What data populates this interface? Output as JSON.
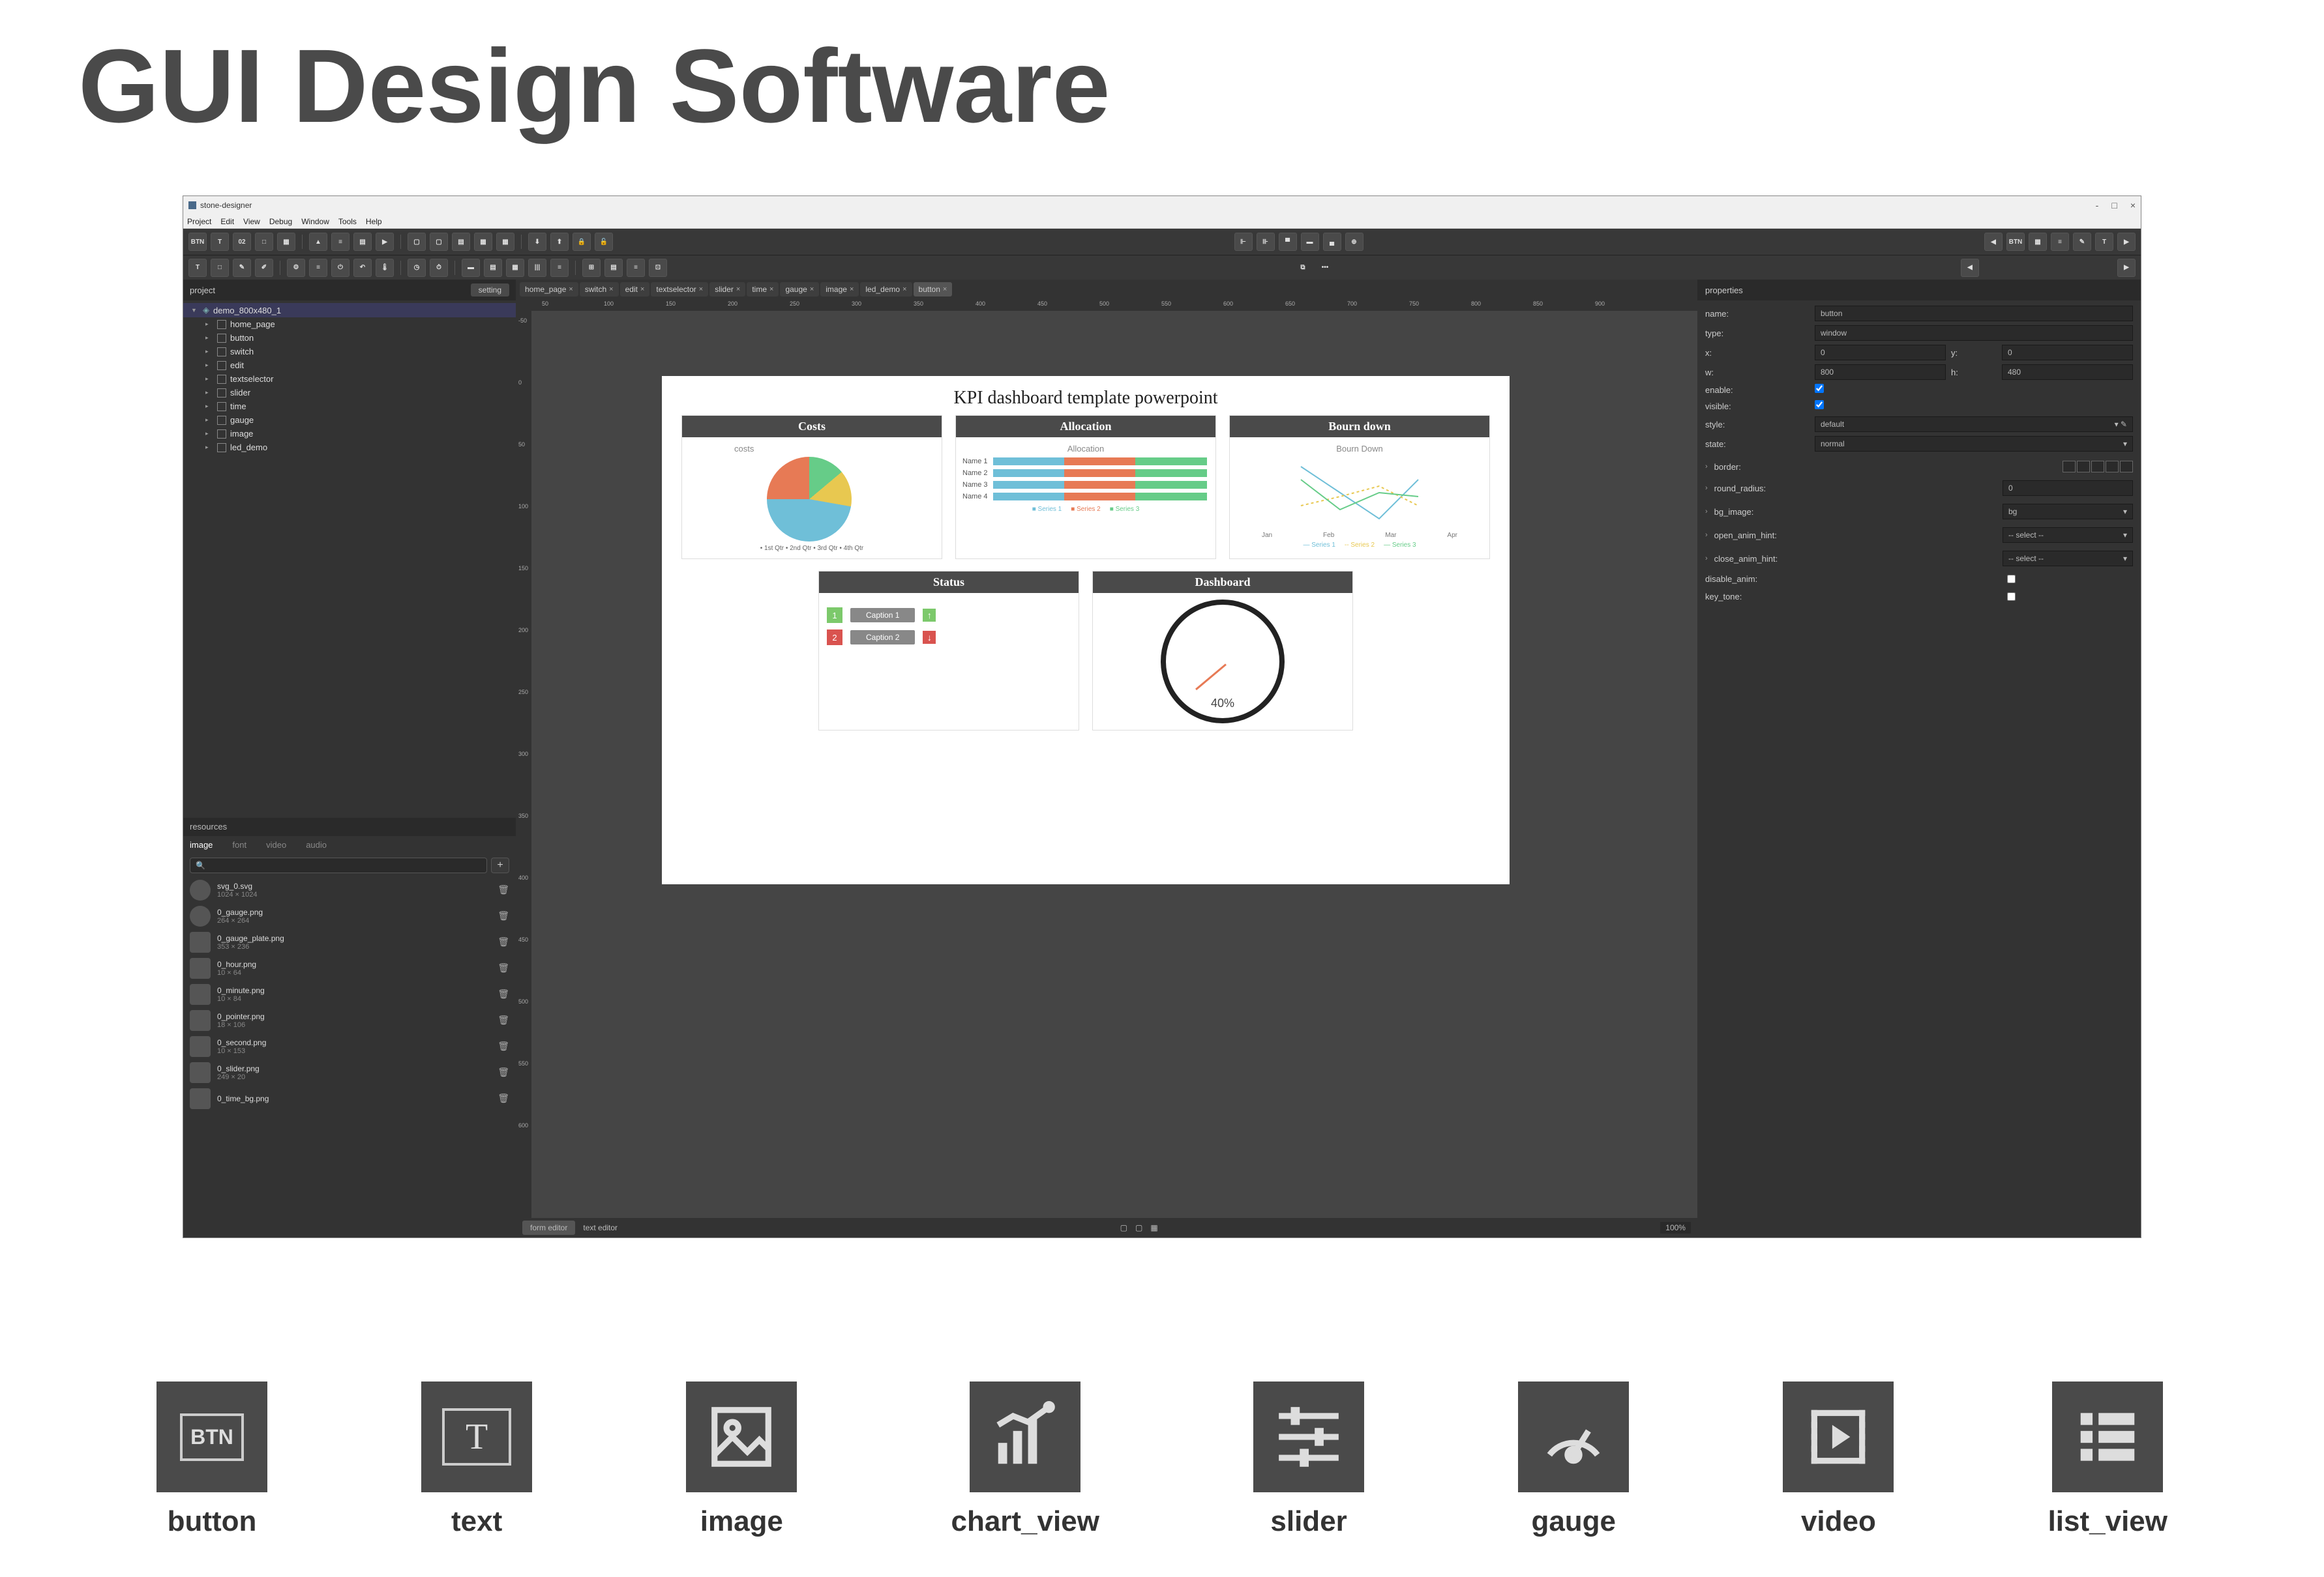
{
  "page_heading": "GUI Design Software",
  "app_title": "stone-designer",
  "menu": [
    "Project",
    "Edit",
    "View",
    "Debug",
    "Window",
    "Tools",
    "Help"
  ],
  "toolbar1_labels": [
    "BTN",
    "T",
    "02",
    "□",
    "▦",
    "",
    "",
    "",
    "",
    "",
    "",
    "",
    "",
    "",
    "",
    "",
    "",
    "",
    "",
    "",
    "",
    "",
    "",
    ""
  ],
  "project_panel": {
    "title": "project",
    "setting": "setting",
    "root": "demo_800x480_1",
    "items": [
      "home_page",
      "button",
      "switch",
      "edit",
      "textselector",
      "slider",
      "time",
      "gauge",
      "image",
      "led_demo"
    ]
  },
  "resources_panel": {
    "title": "resources",
    "tabs": [
      "image",
      "font",
      "video",
      "audio"
    ],
    "search_placeholder": "",
    "items": [
      {
        "name": "svg_0.svg",
        "dim": "1024 × 1024"
      },
      {
        "name": "0_gauge.png",
        "dim": "264 × 264"
      },
      {
        "name": "0_gauge_plate.png",
        "dim": "353 × 236"
      },
      {
        "name": "0_hour.png",
        "dim": "10 × 64"
      },
      {
        "name": "0_minute.png",
        "dim": "10 × 84"
      },
      {
        "name": "0_pointer.png",
        "dim": "18 × 106"
      },
      {
        "name": "0_second.png",
        "dim": "10 × 153"
      },
      {
        "name": "0_slider.png",
        "dim": "249 × 20"
      },
      {
        "name": "0_time_bg.png",
        "dim": ""
      }
    ]
  },
  "tabs": [
    "home_page",
    "switch",
    "edit",
    "textselector",
    "slider",
    "time",
    "gauge",
    "image",
    "led_demo",
    "button"
  ],
  "ruler_h": [
    "50",
    "100",
    "150",
    "200",
    "250",
    "300",
    "350",
    "400",
    "450",
    "500",
    "550",
    "600",
    "650",
    "700",
    "750",
    "800",
    "850",
    "900"
  ],
  "ruler_v": [
    "-50",
    "0",
    "50",
    "100",
    "150",
    "200",
    "250",
    "300",
    "350",
    "400",
    "450",
    "500",
    "550",
    "600"
  ],
  "canvas": {
    "title": "KPI dashboard template powerpoint",
    "costs": {
      "header": "Costs",
      "subtitle": "costs",
      "legend": "• 1st Qtr  • 2nd Qtr  • 3rd Qtr  • 4th Qtr"
    },
    "allocation": {
      "header": "Allocation",
      "subtitle": "Allocation",
      "names": [
        "Name 1",
        "Name 2",
        "Name 3",
        "Name 4"
      ],
      "legend": [
        "Series 1",
        "Series 2",
        "Series 3"
      ]
    },
    "bourn": {
      "header": "Bourn down",
      "subtitle": "Bourn Down",
      "x": [
        "Jan",
        "Feb",
        "Mar",
        "Apr"
      ],
      "legend": [
        "Series 1",
        "Series 2",
        "Series 3"
      ]
    },
    "status": {
      "header": "Status",
      "cap1": "Caption 1",
      "cap2": "Caption 2"
    },
    "dashboard": {
      "header": "Dashboard",
      "pct": "40%"
    }
  },
  "bottom_tabs": {
    "form": "form editor",
    "text": "text editor",
    "zoom": "100%"
  },
  "properties": {
    "title": "properties",
    "name_label": "name:",
    "name": "button",
    "type_label": "type:",
    "type": "window",
    "x_label": "x:",
    "x": "0",
    "y_label": "y:",
    "y": "0",
    "w_label": "w:",
    "w": "800",
    "h_label": "h:",
    "h": "480",
    "enable_label": "enable:",
    "visible_label": "visible:",
    "style_label": "style:",
    "style": "default",
    "state_label": "state:",
    "state": "normal",
    "border_label": "border:",
    "round_label": "round_radius:",
    "round": "0",
    "bg_label": "bg_image:",
    "bg": "bg",
    "open_label": "open_anim_hint:",
    "open": "-- select --",
    "close_label": "close_anim_hint:",
    "close": "-- select --",
    "disable_label": "disable_anim:",
    "key_label": "key_tone:"
  },
  "widgets": [
    {
      "label": "button",
      "icon": "BTN"
    },
    {
      "label": "text",
      "icon": "T"
    },
    {
      "label": "image",
      "icon": "IMG"
    },
    {
      "label": "chart_view",
      "icon": "CHART"
    },
    {
      "label": "slider",
      "icon": "SLD"
    },
    {
      "label": "gauge",
      "icon": "GAUGE"
    },
    {
      "label": "video",
      "icon": "VID"
    },
    {
      "label": "list_view",
      "icon": "LIST"
    }
  ],
  "chart_data": [
    {
      "type": "pie",
      "title": "costs",
      "categories": [
        "1st Qtr",
        "2nd Qtr",
        "3rd Qtr",
        "4th Qtr"
      ],
      "values": [
        15,
        15,
        50,
        20
      ]
    },
    {
      "type": "bar",
      "title": "Allocation",
      "categories": [
        "Name 1",
        "Name 2",
        "Name 3",
        "Name 4"
      ],
      "series": [
        {
          "name": "Series 1",
          "values": [
            2,
            2,
            2,
            2
          ]
        },
        {
          "name": "Series 2",
          "values": [
            2,
            2,
            2,
            2
          ]
        },
        {
          "name": "Series 3",
          "values": [
            2,
            2,
            2,
            2
          ]
        }
      ],
      "orientation": "horizontal",
      "stacked": true,
      "xlim": [
        0,
        6
      ]
    },
    {
      "type": "line",
      "title": "Bourn Down",
      "x": [
        "Jan",
        "Feb",
        "Mar",
        "Apr"
      ],
      "series": [
        {
          "name": "Series 1",
          "values": [
            5,
            3,
            1,
            4
          ]
        },
        {
          "name": "Series 2",
          "values": [
            2,
            3,
            4,
            2
          ]
        },
        {
          "name": "Series 3",
          "values": [
            4,
            2,
            3,
            3
          ]
        }
      ],
      "ylim": [
        0,
        5
      ]
    },
    {
      "type": "gauge",
      "title": "Dashboard",
      "value": 40,
      "min": 0,
      "max": 100,
      "unit": "%"
    }
  ]
}
